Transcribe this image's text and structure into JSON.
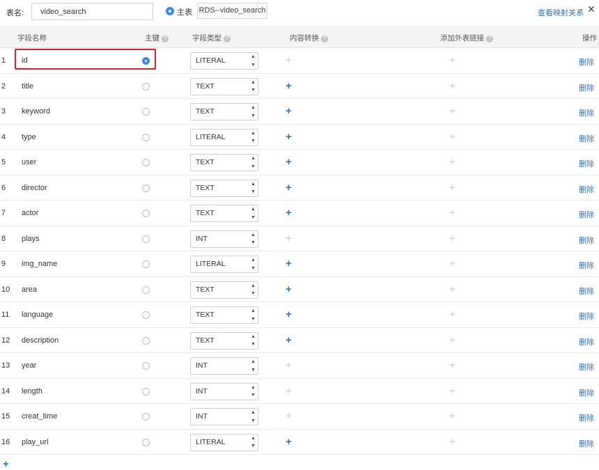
{
  "header": {
    "table_name_label": "表名:",
    "table_name_value": "video_search",
    "main_table_label": "主表",
    "rds_label": "RDS--video_search",
    "mapping_link": "查看映射关系",
    "chevron": "⌄",
    "close": "✕"
  },
  "columns": {
    "name": "字段名称",
    "pk": "主键",
    "type": "字段类型",
    "conversion": "内容转换",
    "fk": "添加外表链接",
    "action": "操作"
  },
  "help_icon": "?",
  "plus_icon": "+",
  "delete_label": "删除",
  "rows": [
    {
      "idx": "1",
      "name": "id",
      "pk": true,
      "type": "LITERAL",
      "conversion": false
    },
    {
      "idx": "2",
      "name": "title",
      "pk": false,
      "type": "TEXT",
      "conversion": true
    },
    {
      "idx": "3",
      "name": "keyword",
      "pk": false,
      "type": "TEXT",
      "conversion": true
    },
    {
      "idx": "4",
      "name": "type",
      "pk": false,
      "type": "LITERAL",
      "conversion": true
    },
    {
      "idx": "5",
      "name": "user",
      "pk": false,
      "type": "TEXT",
      "conversion": true
    },
    {
      "idx": "6",
      "name": "director",
      "pk": false,
      "type": "TEXT",
      "conversion": true
    },
    {
      "idx": "7",
      "name": "actor",
      "pk": false,
      "type": "TEXT",
      "conversion": true
    },
    {
      "idx": "8",
      "name": "plays",
      "pk": false,
      "type": "INT",
      "conversion": false
    },
    {
      "idx": "9",
      "name": "img_name",
      "pk": false,
      "type": "LITERAL",
      "conversion": true
    },
    {
      "idx": "10",
      "name": "area",
      "pk": false,
      "type": "TEXT",
      "conversion": true
    },
    {
      "idx": "11",
      "name": "language",
      "pk": false,
      "type": "TEXT",
      "conversion": true
    },
    {
      "idx": "12",
      "name": "description",
      "pk": false,
      "type": "TEXT",
      "conversion": true
    },
    {
      "idx": "13",
      "name": "year",
      "pk": false,
      "type": "INT",
      "conversion": false
    },
    {
      "idx": "14",
      "name": "length",
      "pk": false,
      "type": "INT",
      "conversion": false
    },
    {
      "idx": "15",
      "name": "creat_time",
      "pk": false,
      "type": "INT",
      "conversion": false
    },
    {
      "idx": "16",
      "name": "play_url",
      "pk": false,
      "type": "LITERAL",
      "conversion": true
    }
  ],
  "colors": {
    "accent": "#2b73d2",
    "radio_on": "#3b8ae6",
    "disabled_plus": "#d7d7d7",
    "highlight": "#e02020"
  }
}
